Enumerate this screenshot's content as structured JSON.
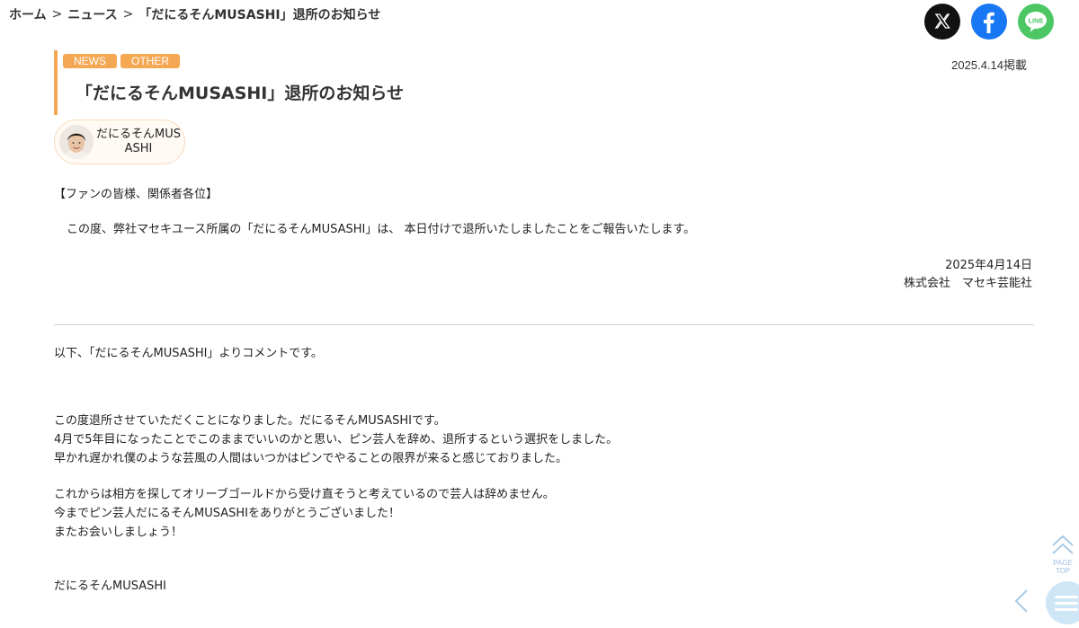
{
  "breadcrumb": {
    "home": "ホーム",
    "news": "ニュース",
    "current": "「だにるそんMUSASHI」退所のお知らせ",
    "separator": ">"
  },
  "social": {
    "x_icon": "x-logo-icon",
    "facebook_icon": "facebook-logo-icon",
    "line_icon": "line-logo-icon",
    "line_text": "LINE"
  },
  "article": {
    "tags": [
      "NEWS",
      "OTHER"
    ],
    "title": "「だにるそんMUSASHI」退所のお知らせ",
    "published": "2025.4.14掲載",
    "talent": {
      "name": "だにるそんMUSASHI"
    },
    "greeting": "【ファンの皆様、関係者各位】",
    "announcement": "この度、弊社マセキユース所属の「だにるそんMUSASHI」は、 本日付けで退所いたしましたことをご報告いたします。",
    "date": "2025年4月14日",
    "company": "株式会社　マセキ芸能社",
    "comment_intro": "以下、「だにるそんMUSASHI」よりコメントです。",
    "comment_p1": [
      "この度退所させていただくことになりました。だにるそんMUSASHIです。",
      "4月で5年目になったことでこのままでいいのかと思い、ピン芸人を辞め、退所するという選択をしました。",
      "早かれ遅かれ僕のような芸風の人間はいつかはピンでやることの限界が来ると感じておりました。"
    ],
    "comment_p2": [
      "これからは相方を探してオリーブゴールドから受け直そうと考えているので芸人は辞めません。",
      "今までピン芸人だにるそんMUSASHIをありがとうございました！",
      "またお会いしましょう！"
    ],
    "signature": "だにるそんMUSASHI"
  },
  "floating": {
    "pagetop_label": "PAGE TOP"
  },
  "colors": {
    "accent": "#f4a854",
    "x": "#111111",
    "facebook": "#1877f2",
    "line": "#4cc764"
  }
}
